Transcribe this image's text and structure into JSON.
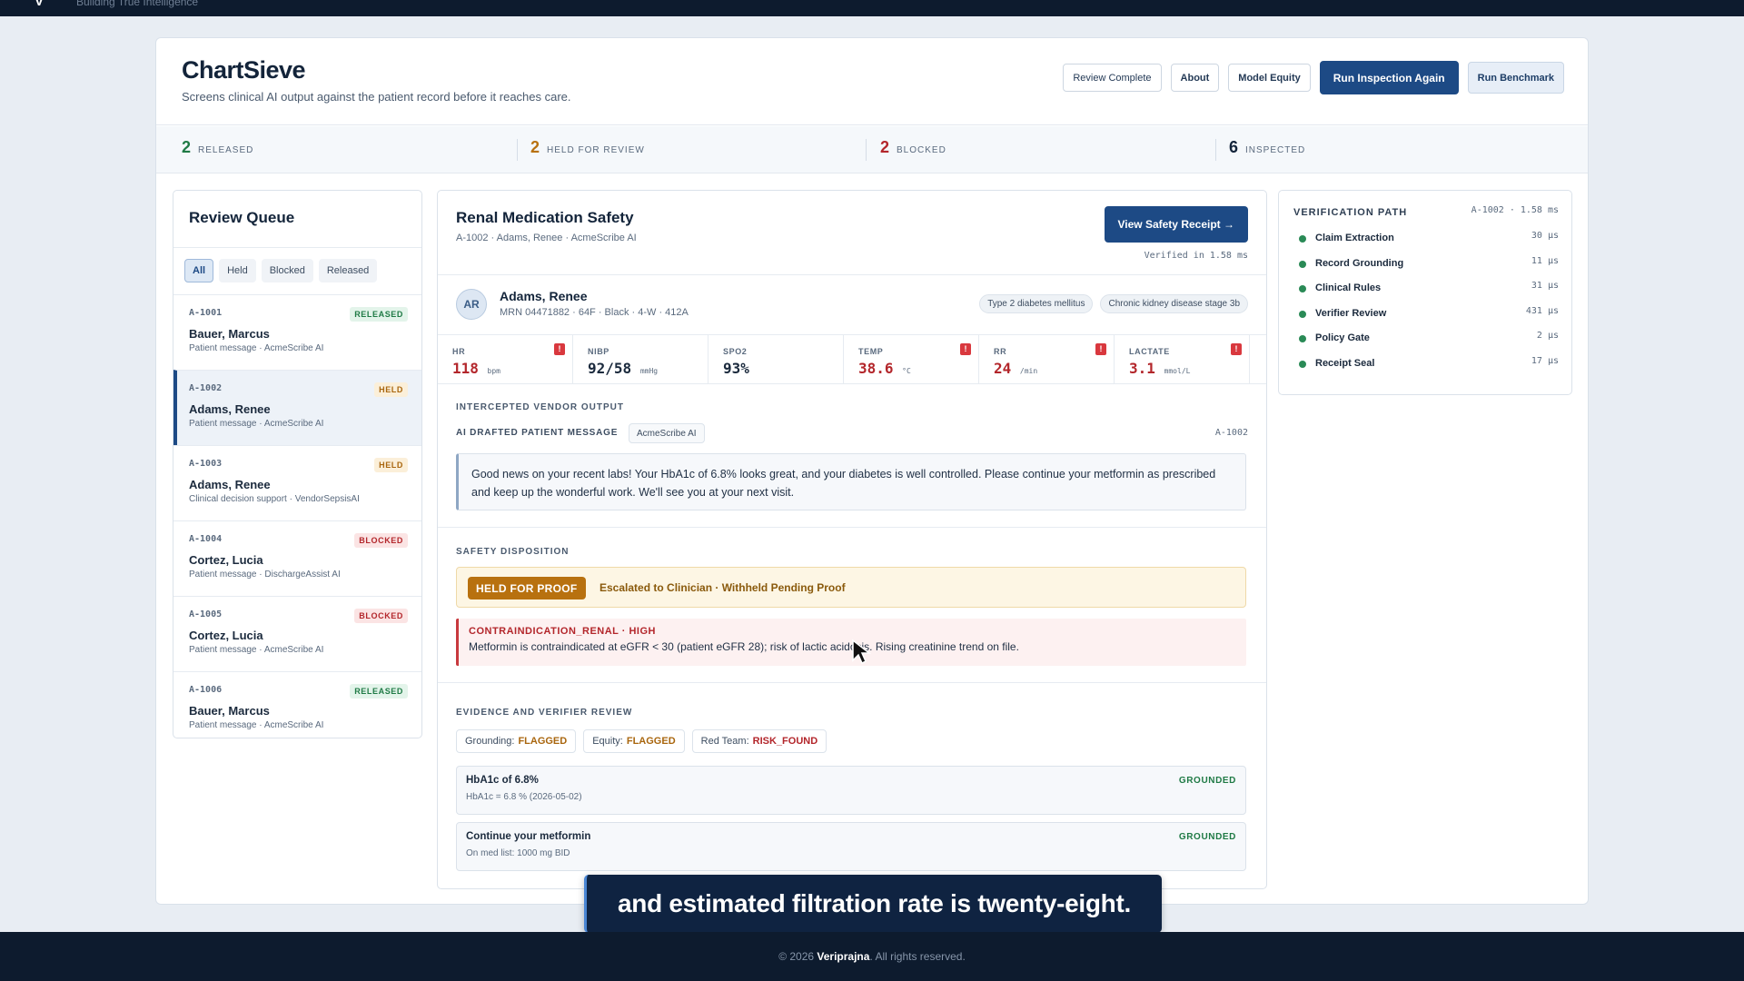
{
  "topbar": {
    "logo": "V",
    "tagline": "Building True Intelligence"
  },
  "header": {
    "title": "ChartSieve",
    "subtitle": "Screens clinical AI output against the patient record before it reaches care.",
    "buttons": {
      "review_complete": "Review Complete",
      "about": "About",
      "model_equity": "Model Equity",
      "run_inspection": "Run Inspection Again",
      "run_benchmark": "Run Benchmark"
    }
  },
  "stats": {
    "released": {
      "count": "2",
      "label": "RELEASED",
      "color": "#1f7a45"
    },
    "held": {
      "count": "2",
      "label": "HELD FOR REVIEW",
      "color": "#b8710f"
    },
    "blocked": {
      "count": "2",
      "label": "BLOCKED",
      "color": "#b3262b"
    },
    "inspected": {
      "count": "6",
      "label": "INSPECTED",
      "color": "#13243a"
    }
  },
  "queue": {
    "title": "Review Queue",
    "filters": [
      "All",
      "Held",
      "Blocked",
      "Released"
    ],
    "active_filter": "All",
    "items": [
      {
        "id": "A-1001",
        "status": "RELEASED",
        "name": "Bauer, Marcus",
        "sub": "Patient message · AcmeScribe AI"
      },
      {
        "id": "A-1002",
        "status": "HELD",
        "name": "Adams, Renee",
        "sub": "Patient message · AcmeScribe AI"
      },
      {
        "id": "A-1003",
        "status": "HELD",
        "name": "Adams, Renee",
        "sub": "Clinical decision support · VendorSepsisAI"
      },
      {
        "id": "A-1004",
        "status": "BLOCKED",
        "name": "Cortez, Lucia",
        "sub": "Patient message · DischargeAssist AI"
      },
      {
        "id": "A-1005",
        "status": "BLOCKED",
        "name": "Cortez, Lucia",
        "sub": "Patient message · AcmeScribe AI"
      },
      {
        "id": "A-1006",
        "status": "RELEASED",
        "name": "Bauer, Marcus",
        "sub": "Patient message · AcmeScribe AI"
      }
    ]
  },
  "main": {
    "title": "Renal Medication Safety",
    "subtitle": "A-1002 · Adams, Renee · AcmeScribe AI",
    "receipt_button": "View Safety Receipt →",
    "verified": "Verified in 1.58 ms",
    "patient": {
      "initials": "AR",
      "name": "Adams, Renee",
      "meta": "MRN 04471882 · 64F · Black · 4-W · 412A",
      "diagnoses": [
        "Type 2 diabetes mellitus",
        "Chronic kidney disease stage 3b"
      ]
    },
    "vitals": [
      {
        "label": "HR",
        "value": "118",
        "unit": "bpm",
        "alert": true
      },
      {
        "label": "NIBP",
        "value": "92/58",
        "unit": "mmHg",
        "alert": false
      },
      {
        "label": "SPO2",
        "value": "93%",
        "unit": "",
        "alert": false
      },
      {
        "label": "TEMP",
        "value": "38.6",
        "unit": "°C",
        "alert": true
      },
      {
        "label": "RR",
        "value": "24",
        "unit": "/min",
        "alert": true
      },
      {
        "label": "LACTATE",
        "value": "3.1",
        "unit": "mmol/L",
        "alert": true
      }
    ],
    "intercepted_title": "INTERCEPTED VENDOR OUTPUT",
    "ai_message_label": "AI DRAFTED PATIENT MESSAGE",
    "vendor": "AcmeScribe AI",
    "message_id": "A-1002",
    "message": "Good news on your recent labs! Your HbA1c of 6.8% looks great, and your diabetes is well controlled. Please continue your metformin as prescribed and keep up the wonderful work. We'll see you at your next visit.",
    "disposition_title": "SAFETY DISPOSITION",
    "disposition_badge": "HELD FOR PROOF",
    "disposition_text": "Escalated to Clinician · Withheld Pending Proof",
    "contra_title": "CONTRAINDICATION_RENAL · HIGH",
    "contra_detail": "Metformin is contraindicated at eGFR < 30 (patient eGFR 28); risk of lactic acidosis. Rising creatinine trend on file.",
    "evidence_title": "EVIDENCE AND VERIFIER REVIEW",
    "evidence_pills": [
      {
        "label": "Grounding:",
        "value": "FLAGGED"
      },
      {
        "label": "Equity:",
        "value": "FLAGGED"
      },
      {
        "label": "Red Team:",
        "value": "RISK_FOUND"
      }
    ],
    "claims": [
      {
        "title": "HbA1c of 6.8%",
        "detail": "HbA1c = 6.8 % (2026-05-02)",
        "status": "GROUNDED"
      },
      {
        "title": "Continue your metformin",
        "detail": "On med list: 1000 mg BID",
        "status": "GROUNDED"
      }
    ]
  },
  "verification": {
    "title": "VERIFICATION PATH",
    "meta": "A-1002 · 1.58 ms",
    "steps": [
      {
        "name": "Claim Extraction",
        "time": "30 µs"
      },
      {
        "name": "Record Grounding",
        "time": "11 µs"
      },
      {
        "name": "Clinical Rules",
        "time": "31 µs"
      },
      {
        "name": "Verifier Review",
        "time": "431 µs"
      },
      {
        "name": "Policy Gate",
        "time": "2 µs"
      },
      {
        "name": "Receipt Seal",
        "time": "17 µs"
      }
    ]
  },
  "caption": "and estimated filtration rate is twenty-eight.",
  "footer": {
    "prefix": "© 2026",
    "brand": "Veriprajna",
    "suffix": ". All rights reserved."
  }
}
